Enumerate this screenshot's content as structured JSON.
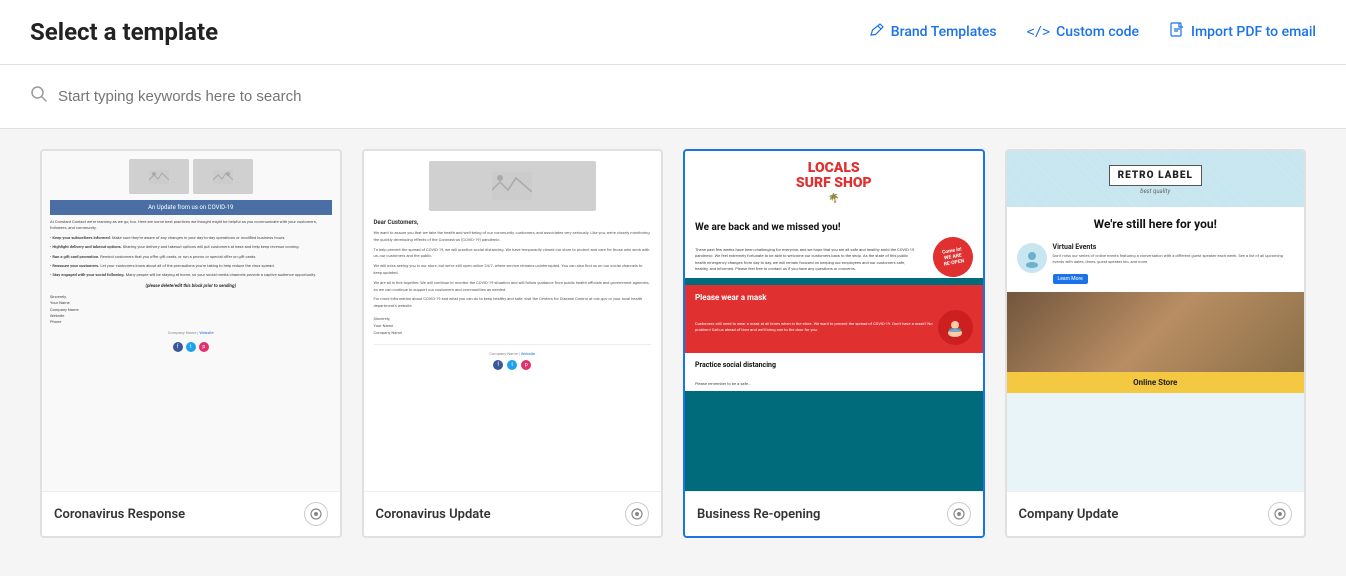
{
  "header": {
    "title": "Select a template",
    "actions": [
      {
        "id": "brand-templates",
        "label": "Brand Templates",
        "icon": "✏️",
        "icon_name": "paint-brush-icon"
      },
      {
        "id": "custom-code",
        "label": "Custom code",
        "icon": "</>",
        "icon_name": "code-icon"
      },
      {
        "id": "import-pdf",
        "label": "Import PDF to email",
        "icon": "📄",
        "icon_name": "pdf-icon"
      }
    ]
  },
  "search": {
    "placeholder": "Start typing keywords here to search"
  },
  "templates": [
    {
      "id": "coronavirus-response",
      "name": "Coronavirus Response",
      "selected": false
    },
    {
      "id": "coronavirus-update",
      "name": "Coronavirus Update",
      "selected": false
    },
    {
      "id": "business-reopening",
      "name": "Business Re-opening",
      "selected": true
    },
    {
      "id": "company-update",
      "name": "Company Update",
      "selected": false
    }
  ],
  "colors": {
    "accent": "#1a73e8",
    "selected_border": "#1a73e8",
    "danger": "#e03030"
  }
}
